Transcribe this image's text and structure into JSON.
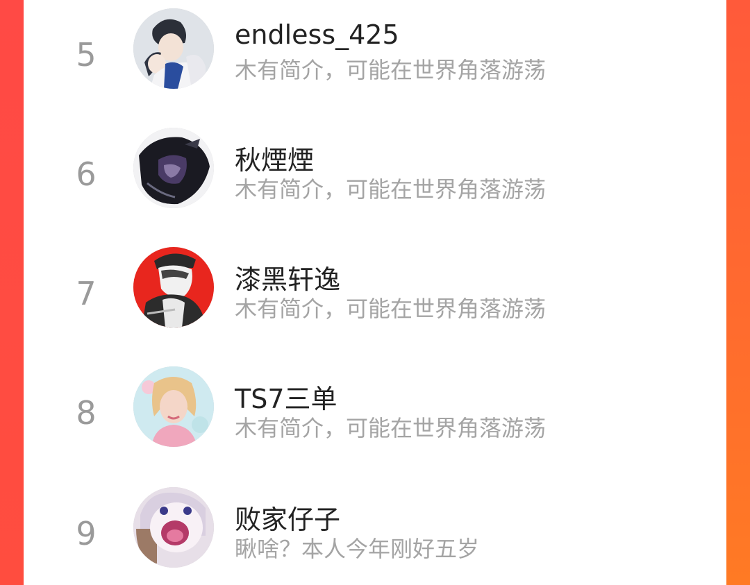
{
  "ranking": [
    {
      "rank": "5",
      "name": "endless_425",
      "bio": "木有简介，可能在世界角落游荡",
      "avatar_icon": "anime-boys-avatar"
    },
    {
      "rank": "6",
      "name": "秋煙煙",
      "bio": "木有简介，可能在世界角落游荡",
      "avatar_icon": "dark-anime-avatar"
    },
    {
      "rank": "7",
      "name": "漆黑轩逸",
      "bio": "木有简介，可能在世界角落游荡",
      "avatar_icon": "red-anime-avatar"
    },
    {
      "rank": "8",
      "name": "TS7三单",
      "bio": "木有简介，可能在世界角落游荡",
      "avatar_icon": "portrait-avatar"
    },
    {
      "rank": "9",
      "name": "败家仔子",
      "bio": "瞅啥？本人今年刚好五岁",
      "avatar_icon": "cartoon-face-avatar"
    }
  ],
  "colors": {
    "background_top": "#ff4b43",
    "background_bottom": "#ff6a2e",
    "rank_text": "#9a9a9a",
    "name_text": "#222222",
    "bio_text": "#a4a4a4"
  }
}
